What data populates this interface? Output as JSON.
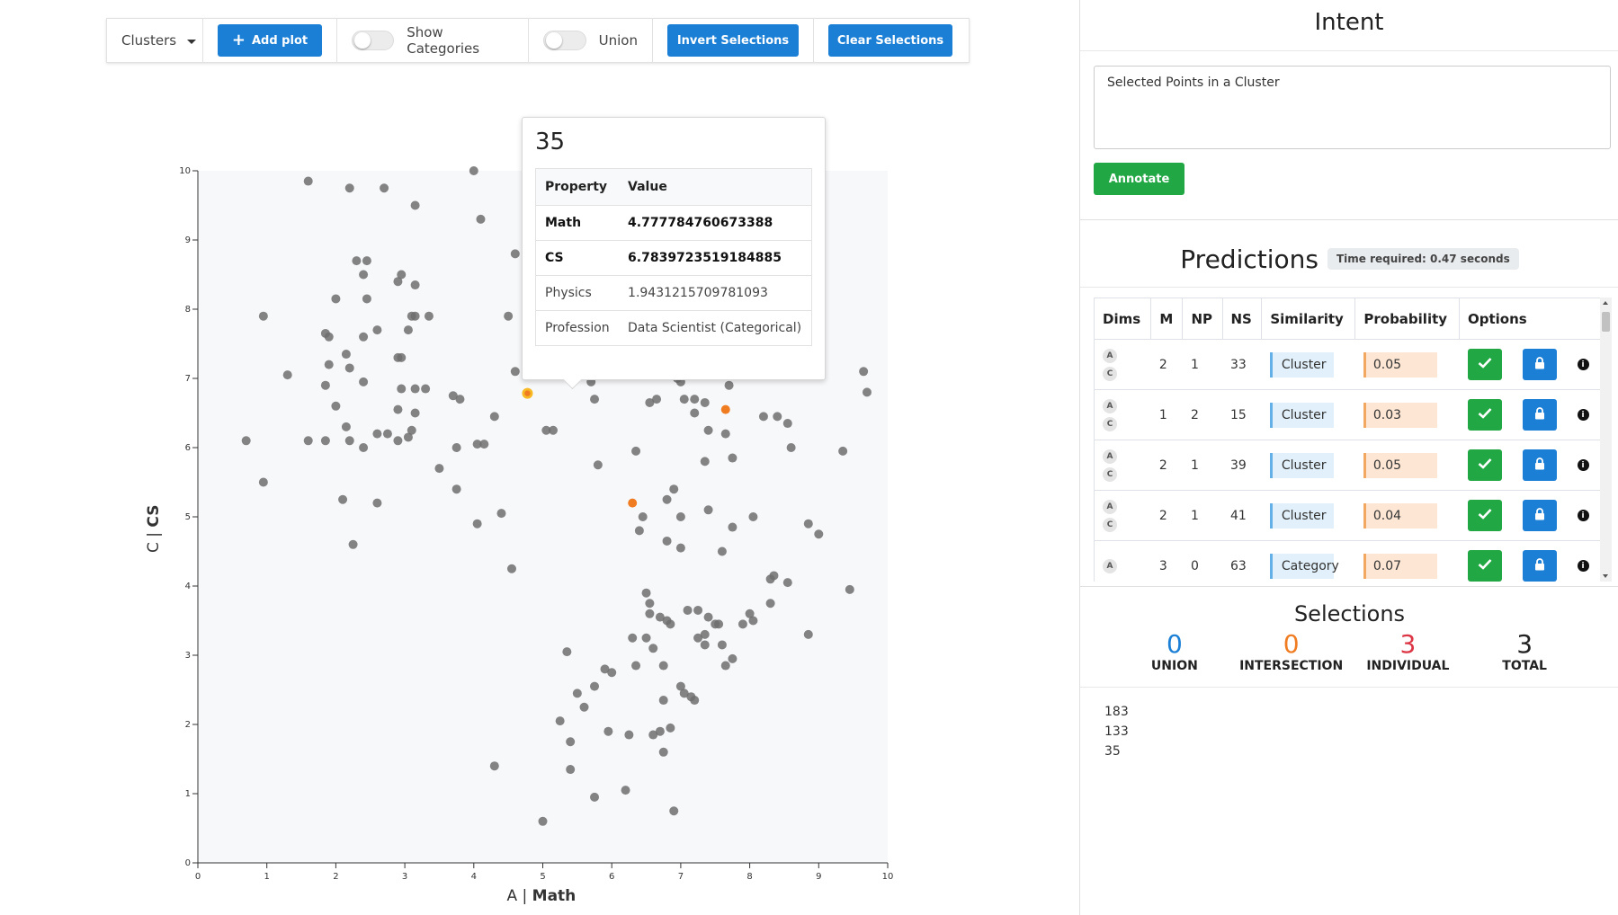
{
  "toolbar": {
    "clusters_label": "Clusters",
    "add_plot_label": "Add plot",
    "show_categories_label": "Show Categories",
    "union_label": "Union",
    "invert_label": "Invert Selections",
    "clear_label": "Clear Selections"
  },
  "tooltip": {
    "title": "35",
    "header": {
      "property": "Property",
      "value": "Value"
    },
    "rows": [
      {
        "property": "Math",
        "value": "4.777784760673388"
      },
      {
        "property": "CS",
        "value": "6.7839723519184885"
      },
      {
        "property": "Physics",
        "value": "1.9431215709781093"
      },
      {
        "property": "Profession",
        "value": "Data Scientist (Categorical)"
      }
    ]
  },
  "intent": {
    "title": "Intent",
    "textarea_value": "Selected Points in a Cluster",
    "annotate_label": "Annotate"
  },
  "predictions": {
    "title": "Predictions",
    "time_badge": "Time required: 0.47 seconds",
    "headers": [
      "Dims",
      "M",
      "NP",
      "NS",
      "Similarity",
      "Probability",
      "Options"
    ],
    "rows": [
      {
        "dims": [
          "A",
          "C"
        ],
        "m": "2",
        "np": "1",
        "ns": "33",
        "similarity": "Cluster",
        "probability": "0.05"
      },
      {
        "dims": [
          "A",
          "C"
        ],
        "m": "1",
        "np": "2",
        "ns": "15",
        "similarity": "Cluster",
        "probability": "0.03"
      },
      {
        "dims": [
          "A",
          "C"
        ],
        "m": "2",
        "np": "1",
        "ns": "39",
        "similarity": "Cluster",
        "probability": "0.05"
      },
      {
        "dims": [
          "A",
          "C"
        ],
        "m": "2",
        "np": "1",
        "ns": "41",
        "similarity": "Cluster",
        "probability": "0.04"
      },
      {
        "dims": [
          "A"
        ],
        "m": "3",
        "np": "0",
        "ns": "63",
        "similarity": "Category",
        "probability": "0.07"
      }
    ]
  },
  "selections": {
    "title": "Selections",
    "stats": [
      {
        "value": "0",
        "label": "UNION",
        "color": "#1b7fd6"
      },
      {
        "value": "0",
        "label": "INTERSECTION",
        "color": "#f07c22"
      },
      {
        "value": "3",
        "label": "INDIVIDUAL",
        "color": "#dc3545"
      },
      {
        "value": "3",
        "label": "TOTAL",
        "color": "#222222"
      }
    ],
    "items": [
      "183",
      "133",
      "35"
    ]
  },
  "chart_data": {
    "type": "scatter",
    "xlabel_prefix": "A | ",
    "xlabel": "Math",
    "ylabel_prefix": "C | ",
    "ylabel": "CS",
    "xlim": [
      0,
      10
    ],
    "ylim": [
      0,
      10
    ],
    "xticks": [
      "0",
      "1",
      "2",
      "3",
      "4",
      "5",
      "6",
      "7",
      "8",
      "9",
      "10"
    ],
    "yticks": [
      "0",
      "1",
      "2",
      "3",
      "4",
      "5",
      "6",
      "7",
      "8",
      "9",
      "10"
    ],
    "colors": {
      "point": "#6e6e6e",
      "selected": "#f07c22",
      "hovered": "#f7b924",
      "background": "#f7f8fa"
    },
    "points": [
      [
        1.6,
        9.85
      ],
      [
        2.2,
        9.75
      ],
      [
        2.7,
        9.75
      ],
      [
        3.15,
        9.5
      ],
      [
        4,
        10
      ],
      [
        4.1,
        9.3
      ],
      [
        4.6,
        8.8
      ],
      [
        0.95,
        7.9
      ],
      [
        2.3,
        8.7
      ],
      [
        2.45,
        8.7
      ],
      [
        2.4,
        8.5
      ],
      [
        2.0,
        8.15
      ],
      [
        2.45,
        8.15
      ],
      [
        2.9,
        8.4
      ],
      [
        2.95,
        8.5
      ],
      [
        3.15,
        8.35
      ],
      [
        1.85,
        7.65
      ],
      [
        1.9,
        7.6
      ],
      [
        2.4,
        7.6
      ],
      [
        2.6,
        7.7
      ],
      [
        3.15,
        7.9
      ],
      [
        3.1,
        7.9
      ],
      [
        3.35,
        7.9
      ],
      [
        3.05,
        7.7
      ],
      [
        4.5,
        7.9
      ],
      [
        1.3,
        7.05
      ],
      [
        1.9,
        7.2
      ],
      [
        2.15,
        7.35
      ],
      [
        2.2,
        7.15
      ],
      [
        2.9,
        7.3
      ],
      [
        2.95,
        7.3
      ],
      [
        1.85,
        6.9
      ],
      [
        2.4,
        6.95
      ],
      [
        2.95,
        6.85
      ],
      [
        3.15,
        6.85
      ],
      [
        3.3,
        6.85
      ],
      [
        3.7,
        6.75
      ],
      [
        3.8,
        6.7
      ],
      [
        2.0,
        6.6
      ],
      [
        2.9,
        6.55
      ],
      [
        3.15,
        6.5
      ],
      [
        0.7,
        6.1
      ],
      [
        1.6,
        6.1
      ],
      [
        1.85,
        6.1
      ],
      [
        2.15,
        6.3
      ],
      [
        2.2,
        6.1
      ],
      [
        2.4,
        6.0
      ],
      [
        2.6,
        6.2
      ],
      [
        2.75,
        6.2
      ],
      [
        2.9,
        6.1
      ],
      [
        3.05,
        6.15
      ],
      [
        3.1,
        6.25
      ],
      [
        3.75,
        6.0
      ],
      [
        4.05,
        6.05
      ],
      [
        4.15,
        6.05
      ],
      [
        4.3,
        6.45
      ],
      [
        0.95,
        5.5
      ],
      [
        2.1,
        5.25
      ],
      [
        2.6,
        5.2
      ],
      [
        3.5,
        5.7
      ],
      [
        3.75,
        5.4
      ],
      [
        4.05,
        4.9
      ],
      [
        4.4,
        5.05
      ],
      [
        2.25,
        4.6
      ],
      [
        4.55,
        4.25
      ],
      [
        4.6,
        7.1
      ],
      [
        5.7,
        6.95
      ],
      [
        5.75,
        6.7
      ],
      [
        6.55,
        6.65
      ],
      [
        6.65,
        6.7
      ],
      [
        6.95,
        7.0
      ],
      [
        7.0,
        6.95
      ],
      [
        7.05,
        6.7
      ],
      [
        7.2,
        6.7
      ],
      [
        7.35,
        6.65
      ],
      [
        7.2,
        6.5
      ],
      [
        7.7,
        6.9
      ],
      [
        5.05,
        6.25
      ],
      [
        5.15,
        6.25
      ],
      [
        7.4,
        6.25
      ],
      [
        7.65,
        6.2
      ],
      [
        6.35,
        5.95
      ],
      [
        5.8,
        5.75
      ],
      [
        7.35,
        5.8
      ],
      [
        7.75,
        5.85
      ],
      [
        8.2,
        6.45
      ],
      [
        8.4,
        6.45
      ],
      [
        8.55,
        6.35
      ],
      [
        8.6,
        6.0
      ],
      [
        9.35,
        5.95
      ],
      [
        9.65,
        7.1
      ],
      [
        9.7,
        6.8
      ],
      [
        6.9,
        5.4
      ],
      [
        6.8,
        5.25
      ],
      [
        6.45,
        5.0
      ],
      [
        6.4,
        4.8
      ],
      [
        7.0,
        5.0
      ],
      [
        7.4,
        5.1
      ],
      [
        7.75,
        4.85
      ],
      [
        8.05,
        5.0
      ],
      [
        8.85,
        4.9
      ],
      [
        9.0,
        4.75
      ],
      [
        6.8,
        4.65
      ],
      [
        7.0,
        4.55
      ],
      [
        7.6,
        4.5
      ],
      [
        8.3,
        4.1
      ],
      [
        8.35,
        4.15
      ],
      [
        8.55,
        4.05
      ],
      [
        9.45,
        3.95
      ],
      [
        6.5,
        3.9
      ],
      [
        6.55,
        3.75
      ],
      [
        7.1,
        3.65
      ],
      [
        7.25,
        3.65
      ],
      [
        7.4,
        3.55
      ],
      [
        7.5,
        3.45
      ],
      [
        7.55,
        3.45
      ],
      [
        7.9,
        3.45
      ],
      [
        8.0,
        3.6
      ],
      [
        8.05,
        3.5
      ],
      [
        8.3,
        3.75
      ],
      [
        6.55,
        3.6
      ],
      [
        6.7,
        3.55
      ],
      [
        6.8,
        3.5
      ],
      [
        6.85,
        3.45
      ],
      [
        6.3,
        3.25
      ],
      [
        6.5,
        3.25
      ],
      [
        6.6,
        3.1
      ],
      [
        7.25,
        3.25
      ],
      [
        7.35,
        3.3
      ],
      [
        7.35,
        3.15
      ],
      [
        7.6,
        3.15
      ],
      [
        7.75,
        2.95
      ],
      [
        7.65,
        2.85
      ],
      [
        8.85,
        3.3
      ],
      [
        5.35,
        3.05
      ],
      [
        5.9,
        2.8
      ],
      [
        6.0,
        2.75
      ],
      [
        6.35,
        2.85
      ],
      [
        6.75,
        2.85
      ],
      [
        7.0,
        2.55
      ],
      [
        7.05,
        2.45
      ],
      [
        7.15,
        2.4
      ],
      [
        7.2,
        2.35
      ],
      [
        5.75,
        2.55
      ],
      [
        5.5,
        2.45
      ],
      [
        5.6,
        2.25
      ],
      [
        6.75,
        2.35
      ],
      [
        5.25,
        2.05
      ],
      [
        5.4,
        1.75
      ],
      [
        5.95,
        1.9
      ],
      [
        6.25,
        1.85
      ],
      [
        6.6,
        1.85
      ],
      [
        6.7,
        1.9
      ],
      [
        6.85,
        1.95
      ],
      [
        6.75,
        1.6
      ],
      [
        4.3,
        1.4
      ],
      [
        5.4,
        1.35
      ],
      [
        5.75,
        0.95
      ],
      [
        6.2,
        1.05
      ],
      [
        6.9,
        0.75
      ],
      [
        5.0,
        0.6
      ]
    ],
    "selected_points": [
      [
        7.65,
        6.55
      ],
      [
        6.3,
        5.2
      ]
    ],
    "hovered_point": [
      4.777784760673388,
      6.7839723519184885
    ]
  }
}
